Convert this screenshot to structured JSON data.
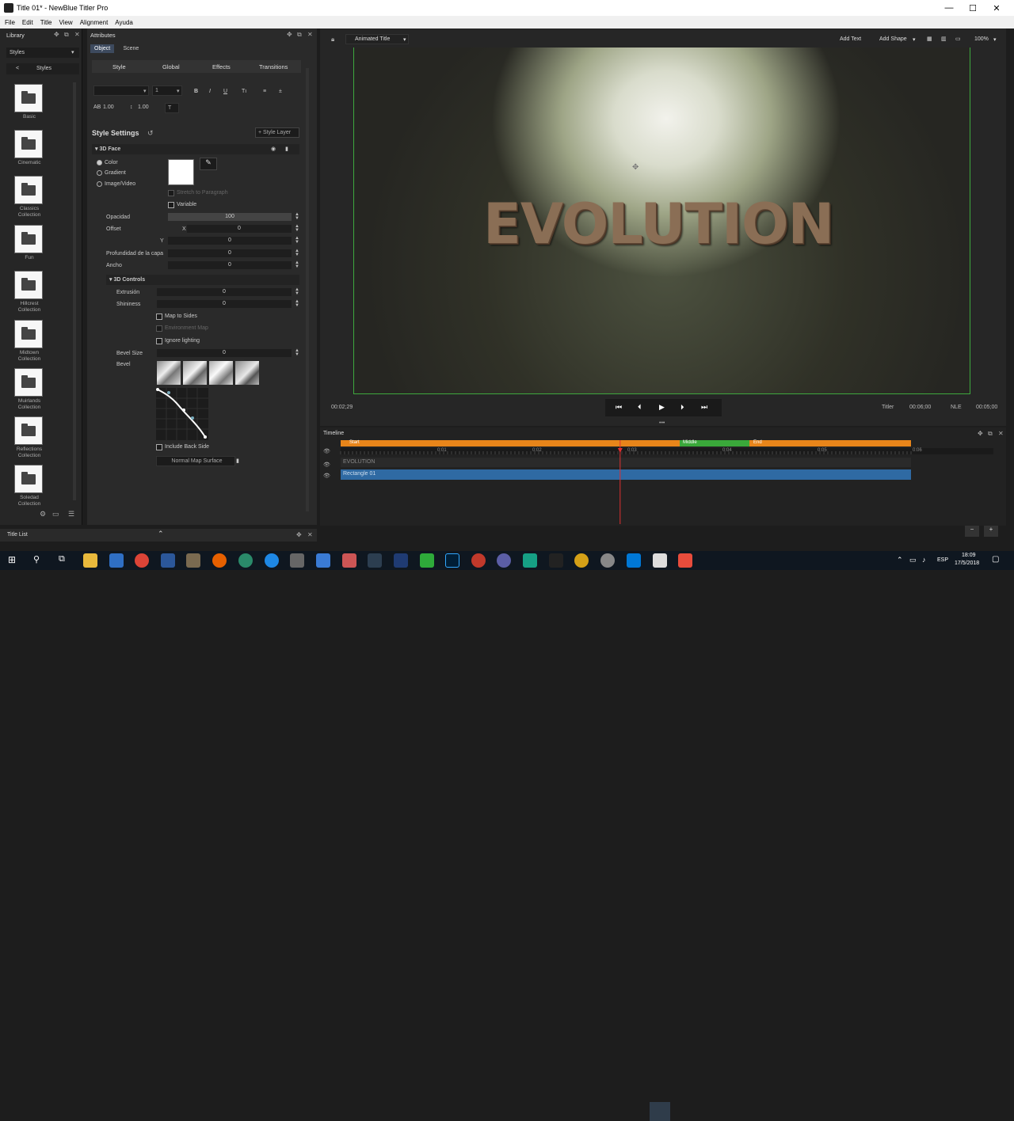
{
  "window": {
    "title": "Title 01* - NewBlue Titler Pro"
  },
  "menu": [
    "File",
    "Edit",
    "Title",
    "View",
    "Alignment",
    "Ayuda"
  ],
  "library": {
    "header": "Library",
    "dropdown": "Styles",
    "back": "<",
    "crumb": "Styles",
    "items": [
      "Basic",
      "Cinematic",
      "Classics Collection",
      "Fun",
      "Hillcrest Collection",
      "Midtown Collection",
      "Muirlands Collection",
      "Reflections Collection",
      "Soledad Collection"
    ]
  },
  "attributes": {
    "header": "Attributes",
    "tabs": [
      "Object",
      "Scene"
    ],
    "subtabs": [
      "Style",
      "Global",
      "Effects",
      "Transitions"
    ],
    "font_size": "1",
    "font_buttons": [
      "B",
      "I",
      "U"
    ],
    "tracking": "1.00",
    "leading": "1.00",
    "style_settings": "Style Settings",
    "style_layer": "+ Style Layer",
    "section_3dface": "3D Face",
    "fill_options": [
      "Color",
      "Gradient",
      "Image/Video"
    ],
    "stretch": "Stretch to Paragraph",
    "variable": "Variable",
    "rows": [
      {
        "label": "Opacidad",
        "value": "100"
      },
      {
        "label": "Offset",
        "sub": "X",
        "value": "0"
      },
      {
        "label": "",
        "sub": "Y",
        "value": "0"
      },
      {
        "label": "Profundidad de la capa",
        "value": "0"
      },
      {
        "label": "Ancho",
        "value": "0"
      }
    ],
    "section_3dcontrols": "3D Controls",
    "rows3d": [
      {
        "label": "Extrusión",
        "value": "0"
      },
      {
        "label": "Shininess",
        "value": "0"
      }
    ],
    "checks3d": [
      "Map to Sides",
      "Environment Map",
      "Ignore lighting"
    ],
    "bevel_size_label": "Bevel Size",
    "bevel_size": "0",
    "bevel_label": "Bevel",
    "include_back": "Include Back Side",
    "normal_map": "Normal Map Surface"
  },
  "viewer": {
    "mode": "Animated Title",
    "add_text": "Add Text",
    "add_shape": "Add Shape",
    "zoom": "100%",
    "canvas_text": "EVOLUTION",
    "current_time": "00:02;29",
    "titler_label": "Titler",
    "titler_time": "00:06;00",
    "nle_label": "NLE",
    "nle_time": "00:05;00"
  },
  "timeline": {
    "header": "Timeline",
    "markers": [
      "Start",
      "Middle",
      "End"
    ],
    "ticks": [
      "0:01",
      "0:02",
      "0:03",
      "0:04",
      "0:05",
      "0:06"
    ],
    "tracks": [
      "EVOLUTION",
      "Rectangle 01"
    ],
    "playhead_fraction": 0.49
  },
  "titlelist": {
    "header": "Title List"
  },
  "taskbar": {
    "lang": "ESP",
    "time": "18:09",
    "date": "17/5/2018"
  }
}
